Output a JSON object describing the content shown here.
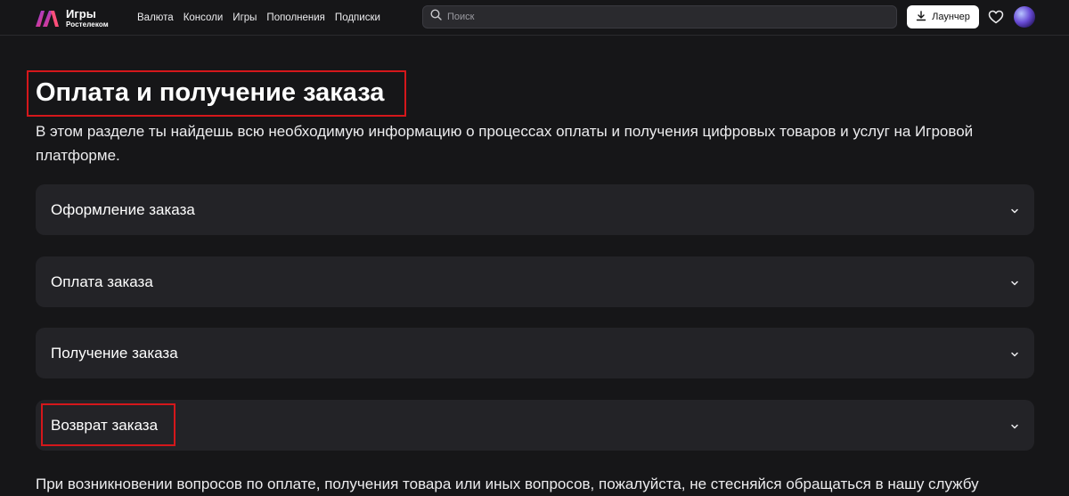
{
  "header": {
    "logo_line1": "Игры",
    "logo_line2": "Ростелеком",
    "nav": [
      "Валюта",
      "Консоли",
      "Игры",
      "Пополнения",
      "Подписки"
    ],
    "search_placeholder": "Поиск",
    "launcher_label": "Лаунчер",
    "icons": [
      "logo-icon",
      "search-icon",
      "download-icon",
      "heart-icon",
      "avatar"
    ]
  },
  "main": {
    "title": "Оплата и получение заказа",
    "intro": "В этом разделе ты найдешь всю необходимую информацию о процессах оплаты и получения цифровых товаров и услуг на Игровой платформе.",
    "accordion": [
      {
        "label": "Оформление заказа"
      },
      {
        "label": "Оплата заказа"
      },
      {
        "label": "Получение заказа"
      },
      {
        "label": "Возврат заказа"
      }
    ],
    "footer_text": "При возникновении вопросов по оплате, получения товара или иных вопросов, пожалуйста, не стесняйся обращаться в нашу службу"
  },
  "colors": {
    "background": "#161618",
    "card": "#232327",
    "highlight": "#d4171b",
    "brand_gradient": [
      "#7b3cff",
      "#ff3b5c"
    ]
  }
}
